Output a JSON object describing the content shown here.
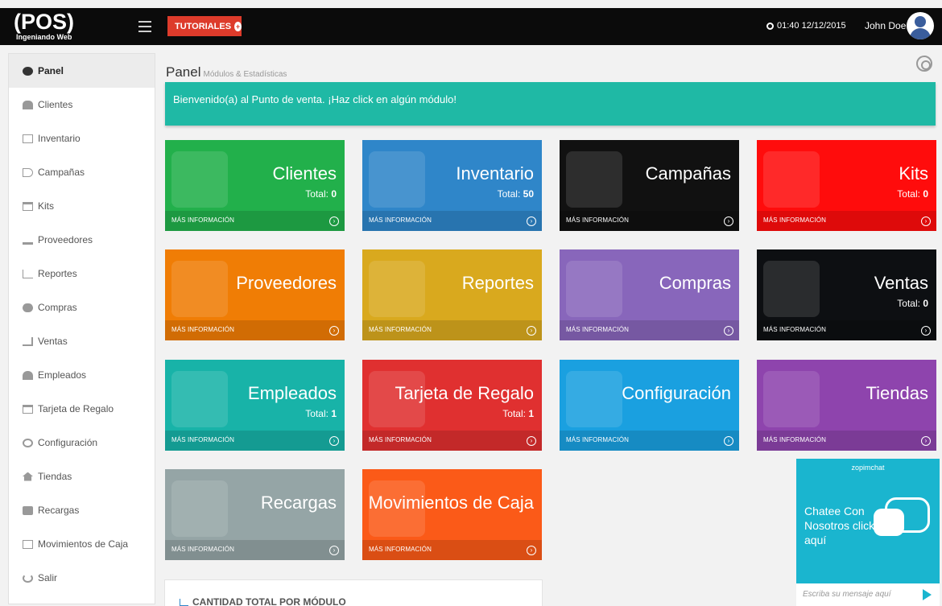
{
  "header": {
    "logo_big": "(POS)",
    "logo_small": "Ingeniando Web",
    "tutorials_label": "TUTORIALES",
    "datetime": "01:40 12/12/2015",
    "user": "John Doe"
  },
  "sidebar": {
    "items": [
      {
        "label": "Panel",
        "icon": "dashboard-icon"
      },
      {
        "label": "Clientes",
        "icon": "users-icon"
      },
      {
        "label": "Inventario",
        "icon": "table-icon"
      },
      {
        "label": "Campañas",
        "icon": "bullhorn-icon"
      },
      {
        "label": "Kits",
        "icon": "inbox-icon"
      },
      {
        "label": "Proveedores",
        "icon": "download-icon"
      },
      {
        "label": "Reportes",
        "icon": "bar-chart-icon"
      },
      {
        "label": "Compras",
        "icon": "cloud-icon"
      },
      {
        "label": "Ventas",
        "icon": "cart-icon"
      },
      {
        "label": "Empleados",
        "icon": "user-icon"
      },
      {
        "label": "Tarjeta de Regalo",
        "icon": "credit-card-icon"
      },
      {
        "label": "Configuración",
        "icon": "cogs-icon"
      },
      {
        "label": "Tiendas",
        "icon": "home-icon"
      },
      {
        "label": "Recargas",
        "icon": "phone-icon"
      },
      {
        "label": "Movimientos de Caja",
        "icon": "money-icon"
      },
      {
        "label": "Salir",
        "icon": "power-icon"
      }
    ]
  },
  "page": {
    "title": "Panel",
    "subtitle": "Módulos & Estadísticas",
    "welcome": "Bienvenido(a) al Punto de venta. ¡Haz click en algún módulo!"
  },
  "tiles": {
    "footer_label": "MÁS INFORMACIÓN",
    "total_label": "Total:",
    "clientes": {
      "title": "Clientes",
      "total": "0",
      "color": "#22b04b"
    },
    "inventario": {
      "title": "Inventario",
      "total": "50",
      "color": "#2f86c9"
    },
    "campanas": {
      "title": "Campañas",
      "color": "#111111"
    },
    "kits": {
      "title": "Kits",
      "total": "0",
      "color": "#ff0c0c"
    },
    "proveedores": {
      "title": "Proveedores",
      "color": "#f07d05"
    },
    "reportes": {
      "title": "Reportes",
      "color": "#d9a91e"
    },
    "compras": {
      "title": "Compras",
      "color": "#8866bb"
    },
    "ventas": {
      "title": "Ventas",
      "total": "0",
      "color": "#0d0f12"
    },
    "empleados": {
      "title": "Empleados",
      "total": "1",
      "color": "#18b3a8"
    },
    "tarjeta": {
      "title": "Tarjeta de Regalo",
      "total": "1",
      "color": "#e03030"
    },
    "configuracion": {
      "title": "Configuración",
      "color": "#1aa0e0"
    },
    "tiendas": {
      "title": "Tiendas",
      "color": "#8e44ad"
    },
    "recargas": {
      "title": "Recargas",
      "color": "#95a5a6"
    },
    "movimientos": {
      "title": "Movimientos de Caja",
      "color": "#fb5a18"
    }
  },
  "chart_panel": {
    "title": "CANTIDAD TOTAL POR MÓDULO"
  },
  "chat": {
    "brand": "zopimchat",
    "cta": "Chatee Con Nosotros click aquí",
    "input_placeholder": "Escriba su mensaje aquí"
  }
}
